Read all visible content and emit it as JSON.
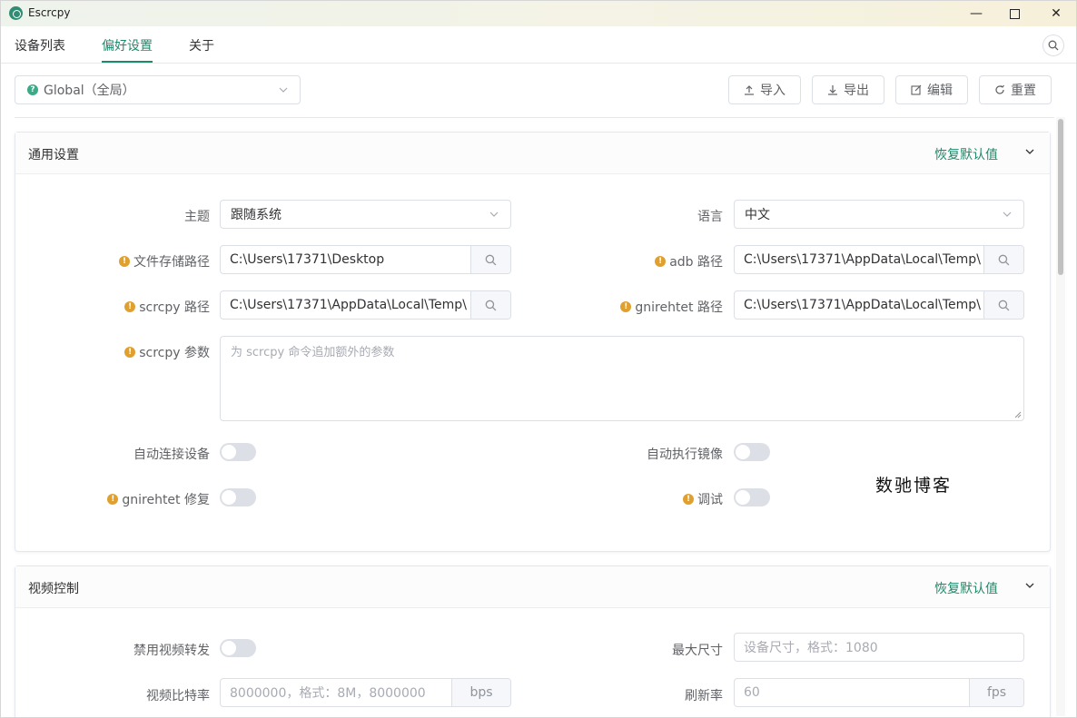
{
  "window": {
    "title": "Escrcpy",
    "minimize": "—",
    "close": "✕"
  },
  "tabs": [
    {
      "label": "设备列表"
    },
    {
      "label": "偏好设置"
    },
    {
      "label": "关于"
    }
  ],
  "toolbar": {
    "scope_select": "Global（全局）",
    "import_label": "导入",
    "export_label": "导出",
    "edit_label": "编辑",
    "reset_label": "重置"
  },
  "general": {
    "title": "通用设置",
    "reset_defaults": "恢复默认值",
    "theme_label": "主题",
    "theme_value": "跟随系统",
    "language_label": "语言",
    "language_value": "中文",
    "save_path_label": "文件存储路径",
    "save_path_value": "C:\\Users\\17371\\Desktop",
    "adb_path_label": "adb 路径",
    "adb_path_value": "C:\\Users\\17371\\AppData\\Local\\Temp\\",
    "scrcpy_path_label": "scrcpy 路径",
    "scrcpy_path_value": "C:\\Users\\17371\\AppData\\Local\\Temp\\",
    "gnirehtet_path_label": "gnirehtet 路径",
    "gnirehtet_path_value": "C:\\Users\\17371\\AppData\\Local\\Temp\\",
    "scrcpy_args_label": "scrcpy 参数",
    "scrcpy_args_placeholder": "为 scrcpy 命令追加额外的参数",
    "auto_connect_label": "自动连接设备",
    "auto_connect": false,
    "auto_mirror_label": "自动执行镜像",
    "auto_mirror": false,
    "gnirehtet_fix_label": "gnirehtet 修复",
    "gnirehtet_fix": false,
    "debug_label": "调试",
    "debug": false
  },
  "video": {
    "title": "视频控制",
    "reset_defaults": "恢复默认值",
    "disable_video_label": "禁用视频转发",
    "disable_video": false,
    "max_size_label": "最大尺寸",
    "max_size_placeholder": "设备尺寸，格式：1080",
    "bitrate_label": "视频比特率",
    "bitrate_placeholder": "8000000，格式：8M，8000000",
    "bitrate_unit": "bps",
    "fps_label": "刷新率",
    "fps_placeholder": "60",
    "fps_unit": "fps"
  },
  "watermark": "数驰博客",
  "colors": {
    "accent": "#1f8a6b",
    "warning": "#e0a030",
    "border": "#dcdfe6"
  }
}
